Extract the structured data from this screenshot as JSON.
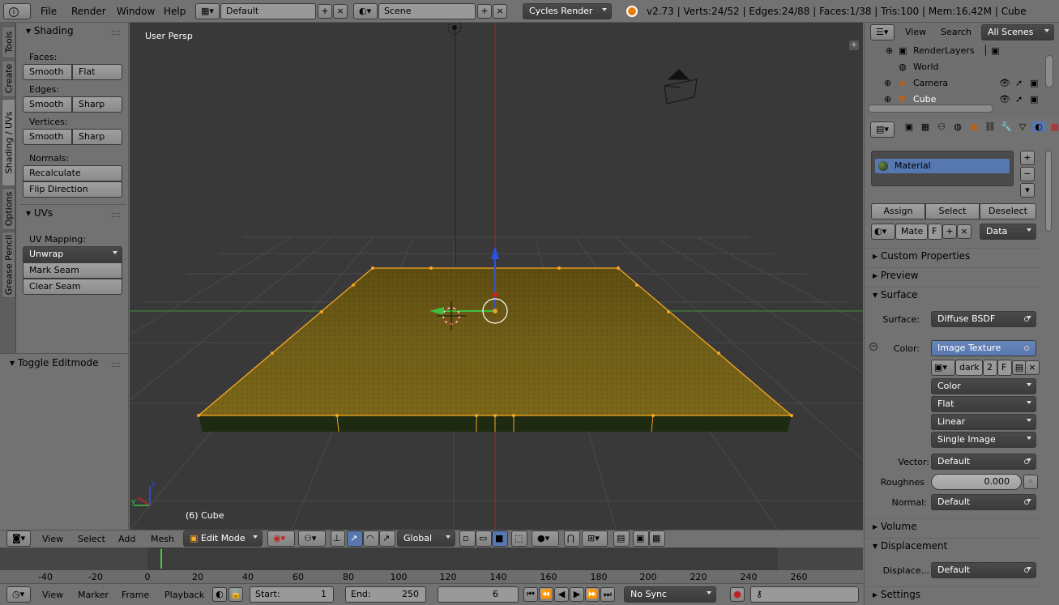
{
  "topbar": {
    "menus": [
      "File",
      "Render",
      "Window",
      "Help"
    ],
    "screen_layout": "Default",
    "scene": "Scene",
    "render_engine": "Cycles Render",
    "stats": "v2.73 | Verts:24/52 | Edges:24/88 | Faces:1/38 | Tris:100 | Mem:16.42M | Cube"
  },
  "tool_tabs": [
    "Tools",
    "Create",
    "Shading / UVs",
    "Options",
    "Grease Pencil"
  ],
  "shading_panel": {
    "title": "Shading",
    "faces_label": "Faces:",
    "faces_buttons": [
      "Smooth",
      "Flat"
    ],
    "edges_label": "Edges:",
    "edges_buttons": [
      "Smooth",
      "Sharp"
    ],
    "vertices_label": "Vertices:",
    "vertices_buttons": [
      "Smooth",
      "Sharp"
    ],
    "normals_label": "Normals:",
    "normals_buttons": [
      "Recalculate",
      "Flip Direction"
    ]
  },
  "uvs_panel": {
    "title": "UVs",
    "mapping_label": "UV Mapping:",
    "unwrap": "Unwrap",
    "buttons": [
      "Mark Seam",
      "Clear Seam"
    ]
  },
  "toggle_editmode": "Toggle Editmode",
  "viewport": {
    "view_name": "User Persp",
    "object_label": "(6) Cube"
  },
  "view3d_header": {
    "menus": [
      "View",
      "Select",
      "Add",
      "Mesh"
    ],
    "mode": "Edit Mode",
    "orientation": "Global"
  },
  "timeline": {
    "ticks": [
      "-40",
      "-20",
      "0",
      "20",
      "40",
      "60",
      "80",
      "100",
      "120",
      "140",
      "160",
      "180",
      "200",
      "220",
      "240",
      "260"
    ],
    "menus": [
      "View",
      "Marker",
      "Frame",
      "Playback"
    ],
    "start_label": "Start:",
    "start_value": "1",
    "end_label": "End:",
    "end_value": "250",
    "current_frame": "6",
    "sync": "No Sync"
  },
  "outliner": {
    "menus": [
      "View",
      "Search"
    ],
    "filter": "All Scenes",
    "items": [
      "RenderLayers",
      "World",
      "Camera",
      "Cube"
    ]
  },
  "properties": {
    "material_slot": "Material",
    "slot_buttons": [
      "Assign",
      "Select",
      "Deselect"
    ],
    "material_name": "Mate",
    "fake_user": "F",
    "link": "Data",
    "panels": {
      "custom_properties": "Custom Properties",
      "preview": "Preview",
      "surface": "Surface",
      "volume": "Volume",
      "displacement": "Displacement",
      "settings": "Settings"
    },
    "surface_label": "Surface:",
    "surface_value": "Diffuse BSDF",
    "color_label": "Color:",
    "color_value": "Image Texture",
    "image_name": "dark",
    "image_users": "2",
    "image_fake": "F",
    "color_space": "Color",
    "projection": "Flat",
    "interpolation": "Linear",
    "source": "Single Image",
    "vector_label": "Vector:",
    "vector_value": "Default",
    "roughness_label": "Roughnes",
    "roughness_value": "0.000",
    "normal_label": "Normal:",
    "normal_value": "Default",
    "displacement_label": "Displace...",
    "displacement_value": "Default"
  },
  "colors": {
    "panel": "#727272",
    "viewport_bg": "#393939",
    "selection_blue": "#5677b0",
    "edge_select": "#f5a623"
  }
}
